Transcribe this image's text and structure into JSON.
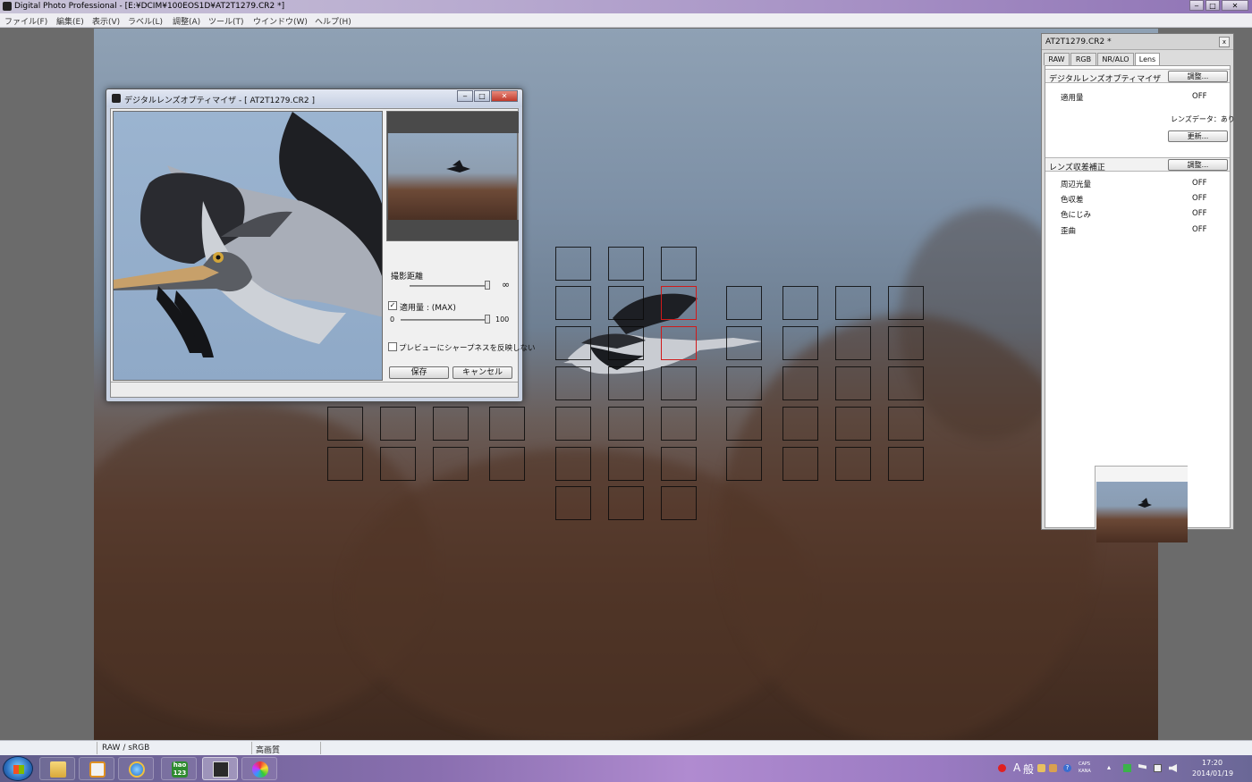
{
  "window": {
    "title": "Digital Photo Professional - [E:¥DCIM¥100EOS1D¥AT2T1279.CR2 *]",
    "controls": [
      "‒",
      "□",
      "✕"
    ]
  },
  "menu": [
    "ファイル(F)",
    "編集(E)",
    "表示(V)",
    "ラベル(L)",
    "調整(A)",
    "ツール(T)",
    "ウインドウ(W)",
    "ヘルプ(H)"
  ],
  "dialog": {
    "title": "デジタルレンズオプティマイザ - [ AT2T1279.CR2 ]",
    "shooting_distance_label": "撮影距離",
    "shooting_distance_value": "∞",
    "apply_checked": true,
    "apply_label": "適用量 : (MAX)",
    "apply_min": "0",
    "apply_max": "100",
    "sharpness_checked": false,
    "sharpness_label": "プレビューにシャープネスを反映しない",
    "save_button": "保存",
    "cancel_button": "キャンセル"
  },
  "palette": {
    "title": "AT2T1279.CR2 *",
    "close": "x",
    "tabs": [
      "RAW",
      "RGB",
      "NR/ALO",
      "Lens"
    ],
    "active_tab": "Lens",
    "dlo_section": {
      "label": "デジタルレンズオプティマイザ",
      "adjust_button": "調整...",
      "apply_label": "適用量",
      "apply_value": "OFF",
      "lens_data_label": "レンズデータ：あり",
      "update_button": "更新..."
    },
    "aberration_section": {
      "label": "レンズ収差補正",
      "adjust_button": "調整...",
      "rows": [
        {
          "label": "周辺光量",
          "value": "OFF"
        },
        {
          "label": "色収差",
          "value": "OFF"
        },
        {
          "label": "色にじみ",
          "value": "OFF"
        },
        {
          "label": "歪曲",
          "value": "OFF"
        }
      ]
    }
  },
  "statusbar": {
    "color_space": "RAW / sRGB",
    "quality": "高画質"
  },
  "taskbar": {
    "tray_ime_a": "A",
    "tray_ime_mode": "般",
    "tray_caps": "CAPS",
    "tray_kana": "KANA",
    "time": "17:20",
    "date": "2014/01/19",
    "hao_label": "hao 123"
  },
  "af_grid": {
    "active_points": 2,
    "total_points": 61
  }
}
